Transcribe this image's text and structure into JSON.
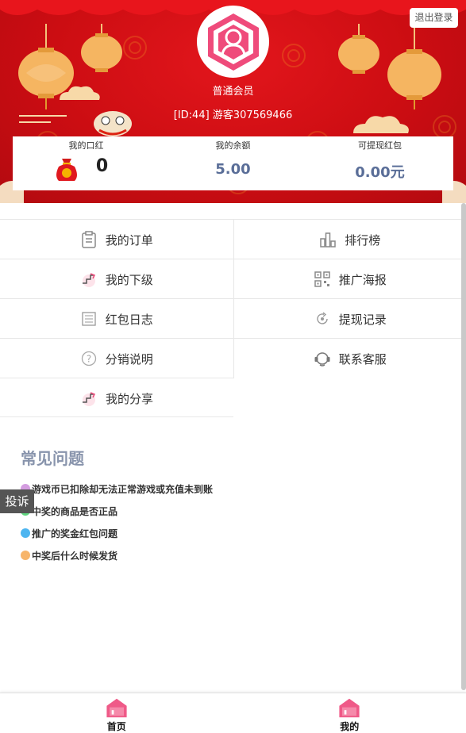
{
  "header": {
    "logout_label": "退出登录",
    "member_level": "普通会员",
    "user_id_text": "[ID:44] 游客307569466"
  },
  "stats": [
    {
      "label": "我的口红",
      "value": "0"
    },
    {
      "label": "我的余额",
      "value": "5.00"
    },
    {
      "label": "可提现红包",
      "value": "0.00元"
    }
  ],
  "menu": [
    {
      "label": "我的订单",
      "icon": "clipboard-icon"
    },
    {
      "label": "排行榜",
      "icon": "bar-chart-icon"
    },
    {
      "label": "我的下级",
      "icon": "steps-icon"
    },
    {
      "label": "推广海报",
      "icon": "qr-code-icon"
    },
    {
      "label": "红包日志",
      "icon": "list-icon"
    },
    {
      "label": "提现记录",
      "icon": "withdraw-icon"
    },
    {
      "label": "分销说明",
      "icon": "question-icon"
    },
    {
      "label": "联系客服",
      "icon": "headset-icon"
    },
    {
      "label": "我的分享",
      "icon": "steps-icon"
    }
  ],
  "faq": {
    "title": "常见问题",
    "items": [
      {
        "text": "游戏币已扣除却无法正常游戏或充值未到账",
        "color": "#d49de0"
      },
      {
        "text": "中奖的商品是否正品",
        "color": "#5fd67f"
      },
      {
        "text": "推广的奖金红包问题",
        "color": "#4db5f0"
      },
      {
        "text": "中奖后什么时候发货",
        "color": "#f7b56a"
      }
    ]
  },
  "complain_label": "投诉",
  "tabs": [
    {
      "label": "首页"
    },
    {
      "label": "我的"
    }
  ],
  "colors": {
    "banner_red": "#cc0d12",
    "accent_pink": "#ec4a7a",
    "stat_blue": "#5a6e98"
  }
}
